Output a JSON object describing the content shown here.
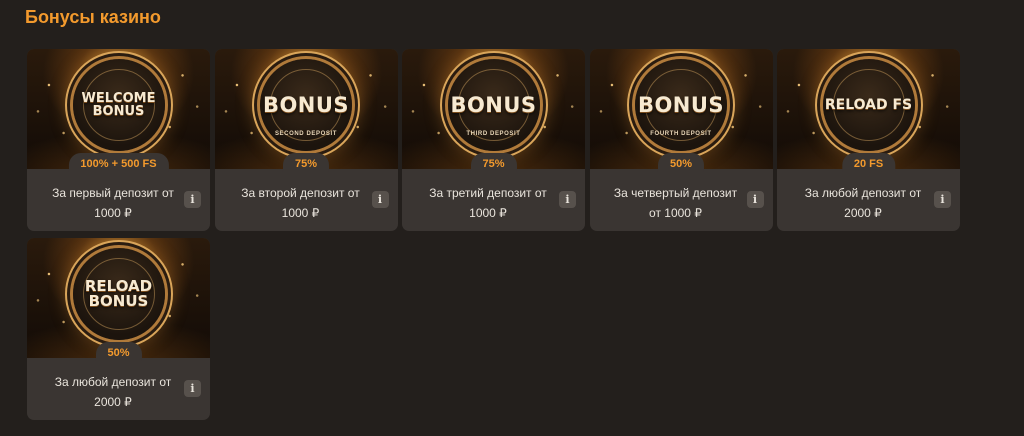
{
  "section": {
    "title": "Бонусы казино"
  },
  "cards": [
    {
      "coin_title": "WELCOME\nBONUS",
      "coin_subtitle": "",
      "badge": "100% + 500 FS",
      "desc_line1": "За первый депозит от",
      "desc_line2": "1000 ₽",
      "info": "i"
    },
    {
      "coin_title": "BONUS",
      "coin_subtitle": "SECOND DEPOSIT",
      "badge": "75%",
      "desc_line1": "За второй депозит от",
      "desc_line2": "1000 ₽",
      "info": "i"
    },
    {
      "coin_title": "BONUS",
      "coin_subtitle": "THIRD DEPOSIT",
      "badge": "75%",
      "desc_line1": "За третий депозит от",
      "desc_line2": "1000 ₽",
      "info": "i"
    },
    {
      "coin_title": "BONUS",
      "coin_subtitle": "FOURTH DEPOSIT",
      "badge": "50%",
      "desc_line1": "За четвертый депозит",
      "desc_line2": "от 1000 ₽",
      "info": "i"
    },
    {
      "coin_title": "RELOAD FS",
      "coin_subtitle": "",
      "badge": "20 FS",
      "desc_line1": "За любой депозит от",
      "desc_line2": "2000 ₽",
      "info": "i"
    },
    {
      "coin_title": "RELOAD\nBONUS",
      "coin_subtitle": "",
      "badge": "50%",
      "desc_line1": "За любой депозит от",
      "desc_line2": "2000 ₽",
      "info": "i"
    }
  ],
  "colors": {
    "background": "#231f1c",
    "card": "#3a3532",
    "accent": "#f39a2d",
    "info_button": "#57514c"
  },
  "icons": {
    "info": "info-icon"
  }
}
